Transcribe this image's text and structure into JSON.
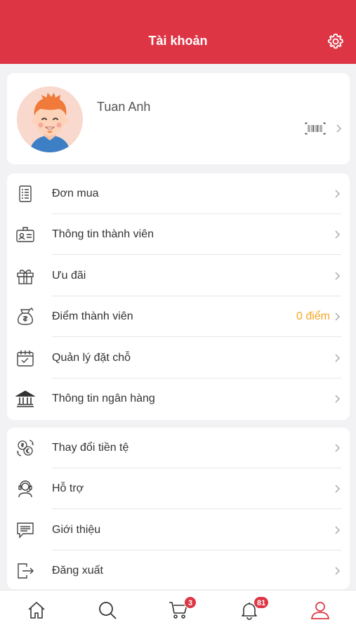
{
  "header": {
    "title": "Tài khoản",
    "settings_icon": "gear-icon"
  },
  "profile": {
    "name": "Tuan Anh",
    "avatar_icon": "avatar-boy-icon",
    "barcode_icon": "barcode-icon"
  },
  "menu_group_1": [
    {
      "label": "Đơn mua",
      "icon": "order-list-icon"
    },
    {
      "label": "Thông tin thành viên",
      "icon": "member-card-icon"
    },
    {
      "label": "Ưu đãi",
      "icon": "gift-icon"
    },
    {
      "label": "Điểm thành viên",
      "icon": "points-bag-icon",
      "value": "0 điểm"
    },
    {
      "label": "Quản lý đặt chỗ",
      "icon": "calendar-check-icon"
    },
    {
      "label": "Thông tin ngân hàng",
      "icon": "bank-icon"
    }
  ],
  "menu_group_2": [
    {
      "label": "Thay đổi tiền tệ",
      "icon": "currency-exchange-icon"
    },
    {
      "label": "Hỗ trợ",
      "icon": "support-headset-icon"
    },
    {
      "label": "Giới thiệu",
      "icon": "message-icon"
    },
    {
      "label": "Đăng xuất",
      "icon": "logout-icon"
    }
  ],
  "tabbar": {
    "home_icon": "home-icon",
    "search_icon": "search-icon",
    "cart_icon": "cart-icon",
    "cart_badge": "3",
    "bell_icon": "bell-icon",
    "bell_badge": "81",
    "account_icon": "user-icon"
  },
  "colors": {
    "accent": "#de3545",
    "points": "#f5a623",
    "background": "#f2f2f4"
  }
}
